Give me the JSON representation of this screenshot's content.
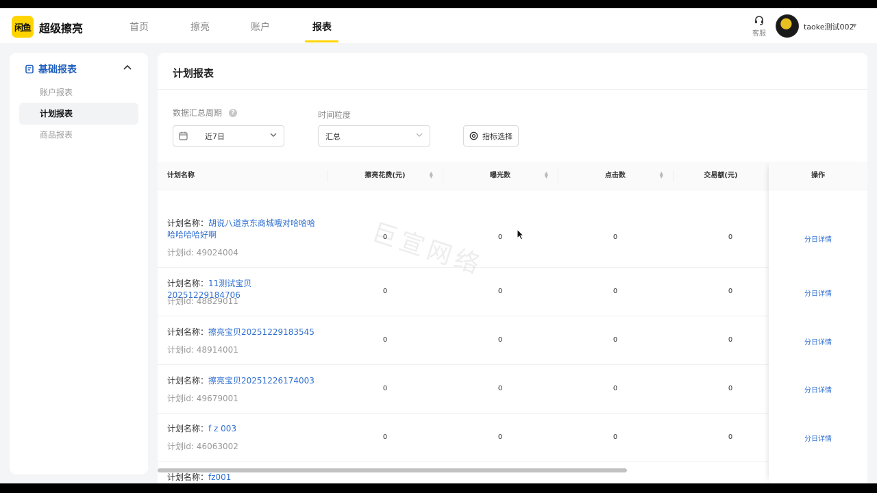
{
  "app": {
    "logo_text": "闲鱼",
    "title": "超级擦亮"
  },
  "nav": {
    "items": [
      {
        "label": "首页"
      },
      {
        "label": "擦亮"
      },
      {
        "label": "账户"
      },
      {
        "label": "报表"
      }
    ],
    "active": "报表",
    "service_label": "客服",
    "username": "taoke测试002"
  },
  "sidebar": {
    "group_label": "基础报表",
    "items": [
      {
        "label": "账户报表"
      },
      {
        "label": "计划报表"
      },
      {
        "label": "商品报表"
      }
    ],
    "active": "计划报表"
  },
  "page": {
    "title": "计划报表",
    "filters": {
      "period_label": "数据汇总周期",
      "period_value": "近7日",
      "granularity_label": "时间粒度",
      "granularity_value": "汇总",
      "metric_button": "指标选择"
    }
  },
  "table": {
    "columns": [
      "计划名称",
      "擦亮花费(元)",
      "曝光数",
      "点击数",
      "交易额(元)",
      "操作"
    ],
    "name_prefix": "计划名称：",
    "rows": [
      {
        "name": "胡说八道京东商城哦对哈哈哈哈哈哈哈好啊",
        "id": "计划id: 49024004",
        "cost": "0",
        "impressions": "0",
        "clicks": "0",
        "gmv": "0",
        "action": "分日详情"
      },
      {
        "name": "11测试宝贝20251229184706",
        "id": "计划id: 48829011",
        "cost": "0",
        "impressions": "0",
        "clicks": "0",
        "gmv": "0",
        "action": "分日详情"
      },
      {
        "name": "擦亮宝贝20251229183545",
        "id": "计划id: 48914001",
        "cost": "0",
        "impressions": "0",
        "clicks": "0",
        "gmv": "0",
        "action": "分日详情"
      },
      {
        "name": "擦亮宝贝20251226174003",
        "id": "计划id: 49679001",
        "cost": "0",
        "impressions": "0",
        "clicks": "0",
        "gmv": "0",
        "action": "分日详情"
      },
      {
        "name": "f z 003",
        "id": "计划id: 46063002",
        "cost": "0",
        "impressions": "0",
        "clicks": "0",
        "gmv": "0",
        "action": "分日详情"
      },
      {
        "name": "fz001"
      }
    ]
  },
  "watermark": "巨宣网络",
  "colors": {
    "accent": "#ffd400",
    "link": "#2f6fd0"
  }
}
